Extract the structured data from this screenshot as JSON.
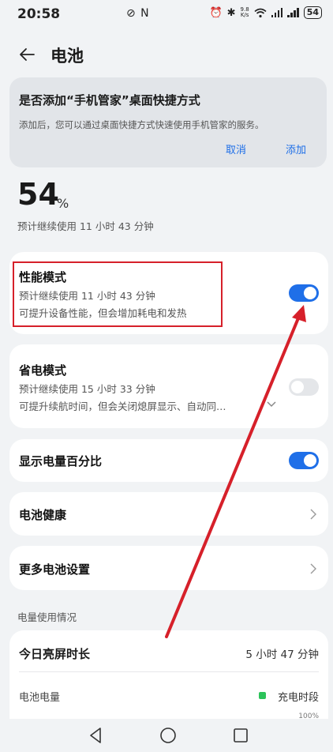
{
  "status_bar": {
    "time": "20:58",
    "mid_icons": "⊘ N",
    "net_speed_top": "9.8",
    "net_speed_bottom": "K/s",
    "battery": "54"
  },
  "header": {
    "title": "电池"
  },
  "banner": {
    "title": "是否添加“手机管家”桌面快捷方式",
    "description": "添加后，您可以通过桌面快捷方式快速使用手机管家的服务。",
    "cancel_label": "取消",
    "add_label": "添加"
  },
  "battery": {
    "percent": "54",
    "percent_symbol": "%",
    "estimate": "预计继续使用 11 小时 43 分钟"
  },
  "performance_mode": {
    "title": "性能模式",
    "estimate": "预计继续使用 11 小时 43 分钟",
    "description": "可提升设备性能，但会增加耗电和发热",
    "enabled": true
  },
  "power_saving_mode": {
    "title": "省电模式",
    "estimate": "预计继续使用 15 小时 33 分钟",
    "description": "可提升续航时间，但会关闭熄屏显示、自动同…",
    "enabled": false
  },
  "show_percentage": {
    "title": "显示电量百分比",
    "enabled": true
  },
  "battery_health": {
    "title": "电池健康"
  },
  "more_settings": {
    "title": "更多电池设置"
  },
  "usage": {
    "section_label": "电量使用情况",
    "screen_time_label": "今日亮屏时长",
    "screen_time_value": "5 小时 47 分钟",
    "level_label": "电池电量",
    "legend_charging": "充电时段",
    "axis_max": "100%"
  },
  "colors": {
    "accent": "#1f6fe8",
    "annotation": "#d6202a",
    "charging": "#2cc35a"
  }
}
